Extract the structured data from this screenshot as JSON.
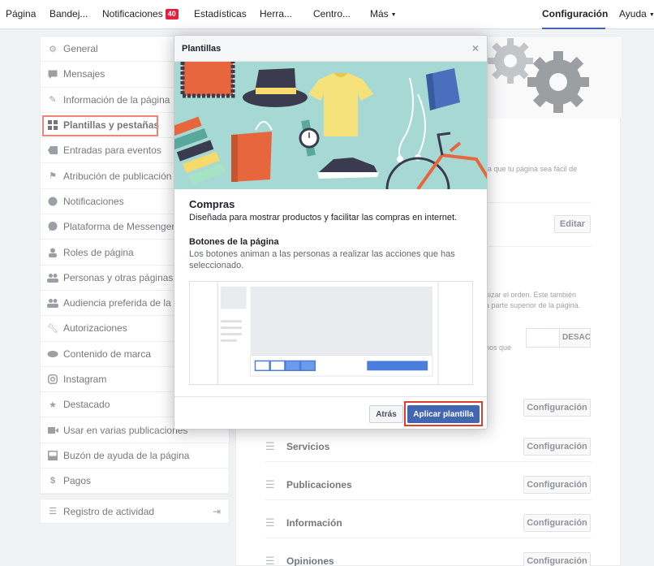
{
  "nav": {
    "items": [
      "Página",
      "Bandej...",
      "Notificaciones",
      "Estadísticas",
      "Herra...",
      "Centro...",
      "Más",
      "Configuración",
      "Ayuda"
    ],
    "notifications_badge": "40"
  },
  "sidebar": {
    "items": [
      {
        "label": "General",
        "icon": "gear-icon"
      },
      {
        "label": "Mensajes",
        "icon": "message-icon"
      },
      {
        "label": "Información de la página",
        "icon": "pencil-icon"
      },
      {
        "label": "Plantillas y pestañas",
        "icon": "grid-icon"
      },
      {
        "label": "Entradas para eventos",
        "icon": "ticket-icon"
      },
      {
        "label": "Atribución de publicación",
        "icon": "flag-icon"
      },
      {
        "label": "Notificaciones",
        "icon": "globe-icon"
      },
      {
        "label": "Plataforma de Messenger",
        "icon": "messenger-icon"
      },
      {
        "label": "Roles de página",
        "icon": "person-icon"
      },
      {
        "label": "Personas y otras páginas",
        "icon": "people-icon"
      },
      {
        "label": "Audiencia preferida de la pági",
        "icon": "audience-icon"
      },
      {
        "label": "Autorizaciones",
        "icon": "wrench-icon"
      },
      {
        "label": "Contenido de marca",
        "icon": "handshake-icon"
      },
      {
        "label": "Instagram",
        "icon": "instagram-icon"
      },
      {
        "label": "Destacado",
        "icon": "star-icon"
      },
      {
        "label": "Usar en varias publicaciones",
        "icon": "video-icon"
      },
      {
        "label": "Buzón de ayuda de la página",
        "icon": "inbox-icon"
      },
      {
        "label": "Pagos",
        "icon": "dollar-icon"
      }
    ],
    "activity_label": "Registro de actividad"
  },
  "background": {
    "peek_texts": [
      "ra que tu página sea fácil de",
      "nizar el orden. Este también",
      "a parte superior de la página.",
      "nos que"
    ],
    "edit_label": "Editar",
    "toggle_label": "DESAC",
    "tabs": [
      {
        "label": "Servicios",
        "button": "Configuración"
      },
      {
        "label": "Publicaciones",
        "button": "Configuración"
      },
      {
        "label": "Información",
        "button": "Configuración"
      },
      {
        "label": "Opiniones",
        "button": "Configuración"
      }
    ],
    "first_row_button": "Configuración"
  },
  "modal": {
    "title": "Plantillas",
    "close": "×",
    "template_name": "Compras",
    "template_desc": "Diseñada para mostrar productos y facilitar las compras en internet.",
    "buttons_heading": "Botones de la página",
    "buttons_desc": "Los botones animan a las personas a realizar las acciones que has seleccionado.",
    "back_label": "Atrás",
    "apply_label": "Aplicar plantilla"
  },
  "colors": {
    "accent": "#4267b2",
    "highlight": "#e03d2a",
    "hero_bg": "#a6d9d3"
  }
}
